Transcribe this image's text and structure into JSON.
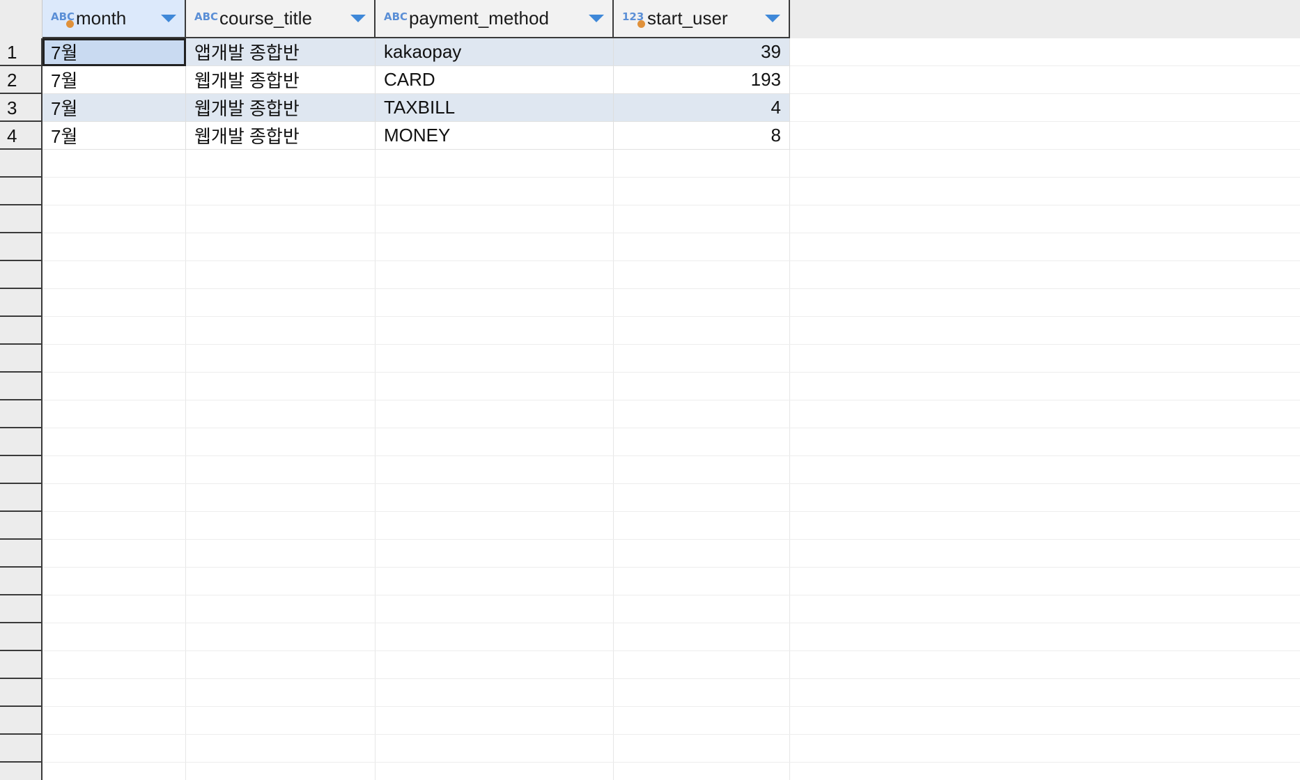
{
  "columns": [
    {
      "name": "month",
      "type_icon": "text-type-icon",
      "type_label": "ABC"
    },
    {
      "name": "course_title",
      "type_icon": "text-type-icon",
      "type_label": "ABC"
    },
    {
      "name": "payment_method",
      "type_icon": "text-type-icon",
      "type_label": "ABC"
    },
    {
      "name": "start_user",
      "type_icon": "numeric-type-icon",
      "type_label": "123"
    }
  ],
  "rows": [
    {
      "num": "1",
      "month": "7월",
      "course_title": "앱개발 종합반",
      "payment_method": "kakaopay",
      "start_user": "39"
    },
    {
      "num": "2",
      "month": "7월",
      "course_title": "웹개발 종합반",
      "payment_method": "CARD",
      "start_user": "193"
    },
    {
      "num": "3",
      "month": "7월",
      "course_title": "웹개발 종합반",
      "payment_method": "TAXBILL",
      "start_user": "4"
    },
    {
      "num": "4",
      "month": "7월",
      "course_title": "웹개발 종합반",
      "payment_method": "MONEY",
      "start_user": "8"
    }
  ],
  "colors": {
    "accent": "#3f88d8",
    "stripe": "#dfe7f1",
    "selected": "#c9daf1",
    "key_dot": "#e0913a"
  }
}
